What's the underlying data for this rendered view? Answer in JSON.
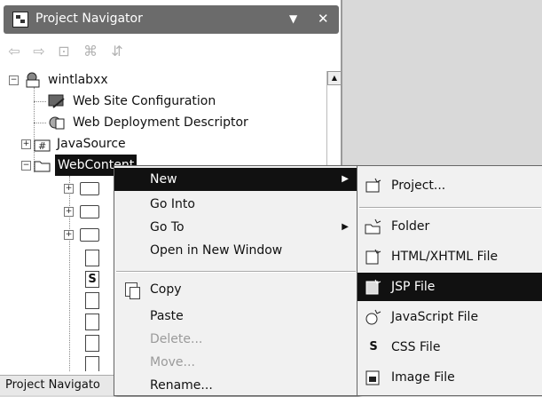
{
  "view": {
    "title": "Project Navigator",
    "menu_glyph": "▼",
    "close_glyph": "✕",
    "bottom_tab": "Project Navigato"
  },
  "toolbar": {
    "icons": [
      "back-icon",
      "forward-icon",
      "up-icon",
      "collapse-all-icon",
      "link-icon"
    ],
    "glyphs": [
      "⇦",
      "⇨",
      "⊡",
      "⌘",
      "⇵"
    ]
  },
  "tree": {
    "project": "wintlabxx",
    "web_site_config": "Web Site Configuration",
    "web_deployment": "Web Deployment Descriptor",
    "java_source": "JavaSource",
    "web_content": "WebContent"
  },
  "context_menu": {
    "items": [
      {
        "label": "New",
        "submenu": true,
        "state": "active"
      },
      {
        "label": "Go Into",
        "submenu": false,
        "state": "normal"
      },
      {
        "label": "Go To",
        "submenu": true,
        "state": "normal"
      },
      {
        "label": "Open in New Window",
        "submenu": false,
        "state": "normal"
      },
      {
        "label": "Copy",
        "submenu": false,
        "state": "normal"
      },
      {
        "label": "Paste",
        "submenu": false,
        "state": "normal"
      },
      {
        "label": "Delete...",
        "submenu": false,
        "state": "disabled"
      },
      {
        "label": "Move...",
        "submenu": false,
        "state": "disabled"
      },
      {
        "label": "Rename...",
        "submenu": false,
        "state": "normal"
      }
    ]
  },
  "submenu": {
    "items": [
      {
        "label": "Project...",
        "icon": "new-project-icon"
      },
      {
        "label": "Folder",
        "icon": "new-folder-icon"
      },
      {
        "label": "HTML/XHTML File",
        "icon": "html-file-icon"
      },
      {
        "label": "JSP File",
        "icon": "jsp-file-icon",
        "state": "active"
      },
      {
        "label": "JavaScript File",
        "icon": "javascript-file-icon"
      },
      {
        "label": "CSS File",
        "icon": "css-file-icon"
      },
      {
        "label": "Image File",
        "icon": "image-file-icon"
      }
    ]
  }
}
